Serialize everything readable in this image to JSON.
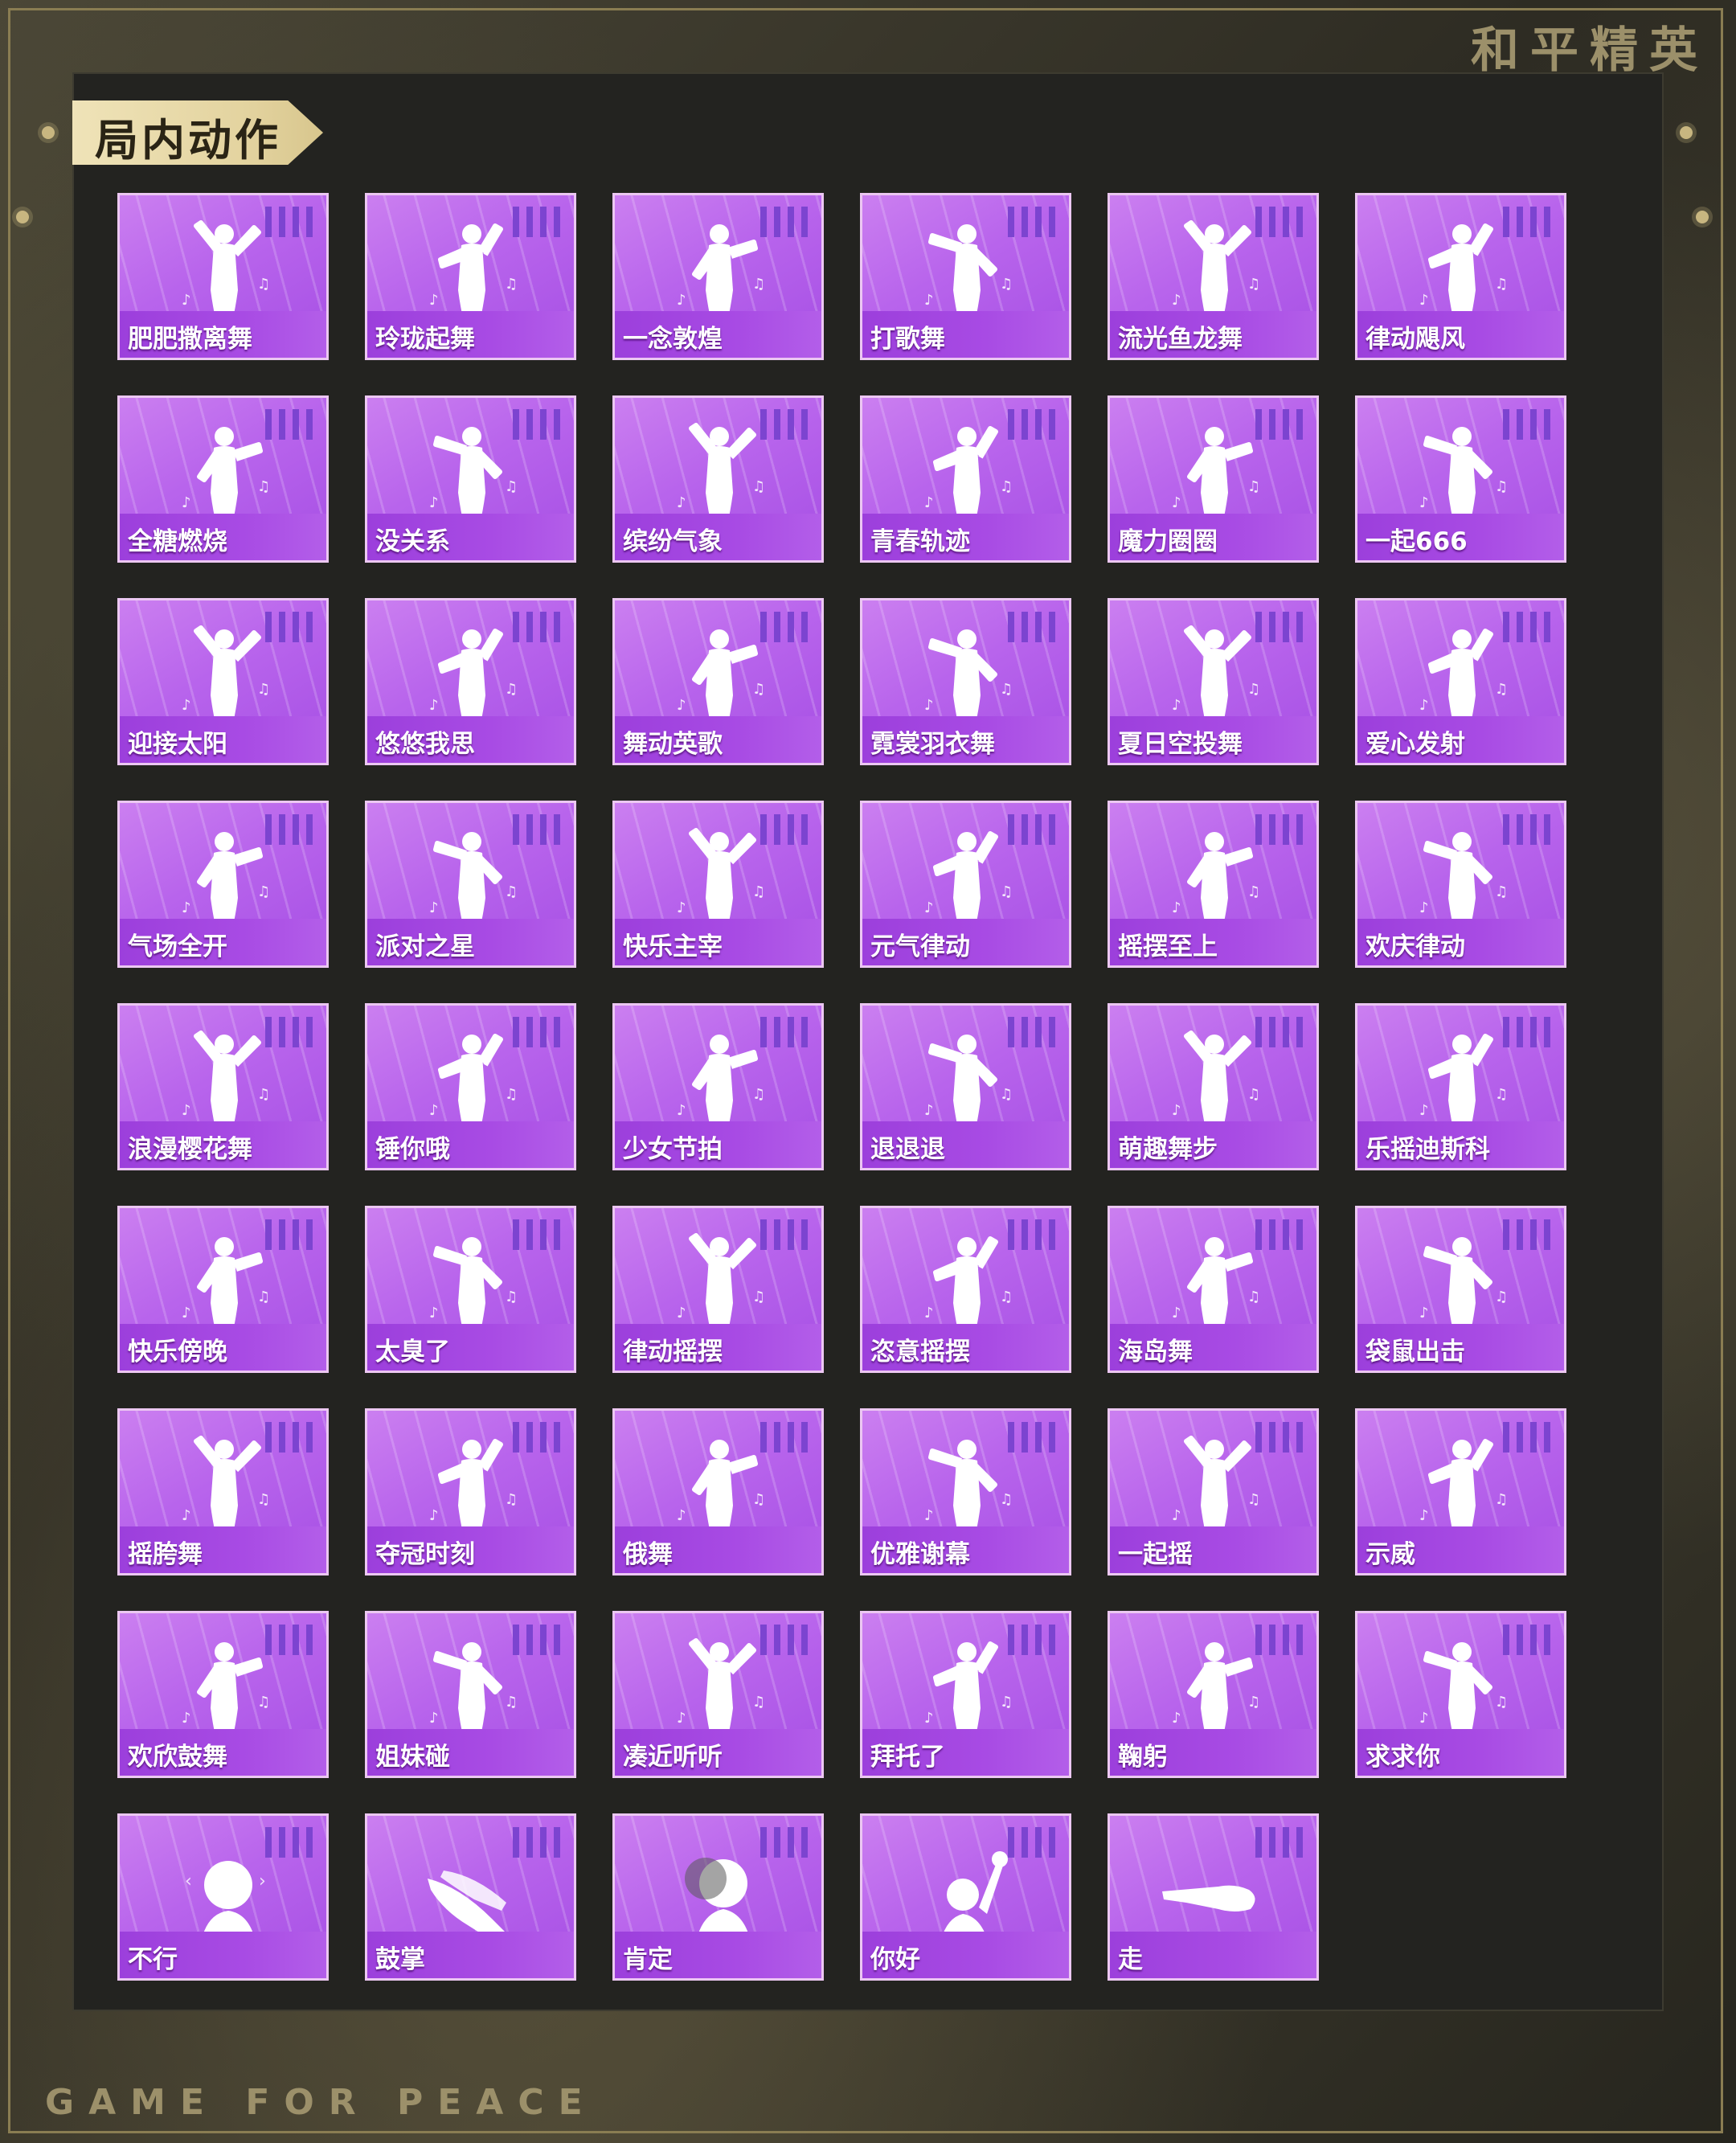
{
  "header": {
    "brand": "和平精英",
    "section_title": "局内动作",
    "slogan": "GAME FOR PEACE"
  },
  "colors": {
    "card_purple": "#b864ec",
    "card_border": "#ecc7f2",
    "title_tag": "#e8dbaa",
    "gold": "#9c906a"
  },
  "emotes": [
    {
      "label": "肥肥撒离舞",
      "icon": "dancer-icon"
    },
    {
      "label": "玲珑起舞",
      "icon": "dancer-icon"
    },
    {
      "label": "一念敦煌",
      "icon": "dancer-icon"
    },
    {
      "label": "打歌舞",
      "icon": "dancer-icon"
    },
    {
      "label": "流光鱼龙舞",
      "icon": "dancer-icon"
    },
    {
      "label": "律动飓风",
      "icon": "dancer-icon"
    },
    {
      "label": "全糖燃烧",
      "icon": "dancer-icon"
    },
    {
      "label": "没关系",
      "icon": "dancer-icon"
    },
    {
      "label": "缤纷气象",
      "icon": "dancer-icon"
    },
    {
      "label": "青春轨迹",
      "icon": "dancer-icon"
    },
    {
      "label": "魔力圈圈",
      "icon": "dancer-icon"
    },
    {
      "label": "一起666",
      "icon": "dancer-icon"
    },
    {
      "label": "迎接太阳",
      "icon": "dancer-icon"
    },
    {
      "label": "悠悠我思",
      "icon": "dancer-icon"
    },
    {
      "label": "舞动英歌",
      "icon": "dancer-icon"
    },
    {
      "label": "霓裳羽衣舞",
      "icon": "dancer-icon"
    },
    {
      "label": "夏日空投舞",
      "icon": "dancer-icon"
    },
    {
      "label": "爱心发射",
      "icon": "dancer-icon"
    },
    {
      "label": "气场全开",
      "icon": "dancer-icon"
    },
    {
      "label": "派对之星",
      "icon": "dancer-icon"
    },
    {
      "label": "快乐主宰",
      "icon": "dancer-icon"
    },
    {
      "label": "元气律动",
      "icon": "dancer-icon"
    },
    {
      "label": "摇摆至上",
      "icon": "dancer-icon"
    },
    {
      "label": "欢庆律动",
      "icon": "dancer-icon"
    },
    {
      "label": "浪漫樱花舞",
      "icon": "dancer-icon"
    },
    {
      "label": "锤你哦",
      "icon": "dancer-icon"
    },
    {
      "label": "少女节拍",
      "icon": "dancer-icon"
    },
    {
      "label": "退退退",
      "icon": "dancer-icon"
    },
    {
      "label": "萌趣舞步",
      "icon": "dancer-icon"
    },
    {
      "label": "乐摇迪斯科",
      "icon": "dancer-icon"
    },
    {
      "label": "快乐傍晚",
      "icon": "dancer-icon"
    },
    {
      "label": "太臭了",
      "icon": "dancer-icon"
    },
    {
      "label": "律动摇摆",
      "icon": "dancer-icon"
    },
    {
      "label": "恣意摇摆",
      "icon": "dancer-icon"
    },
    {
      "label": "海岛舞",
      "icon": "dancer-icon"
    },
    {
      "label": "袋鼠出击",
      "icon": "dancer-icon"
    },
    {
      "label": "摇胯舞",
      "icon": "dancer-icon"
    },
    {
      "label": "夺冠时刻",
      "icon": "dancer-icon"
    },
    {
      "label": "俄舞",
      "icon": "dancer-icon"
    },
    {
      "label": "优雅谢幕",
      "icon": "dancer-icon"
    },
    {
      "label": "一起摇",
      "icon": "dancer-icon"
    },
    {
      "label": "示威",
      "icon": "dancer-icon"
    },
    {
      "label": "欢欣鼓舞",
      "icon": "dancer-icon"
    },
    {
      "label": "姐妹碰",
      "icon": "dancer-icon"
    },
    {
      "label": "凑近听听",
      "icon": "dancer-icon"
    },
    {
      "label": "拜托了",
      "icon": "dancer-icon"
    },
    {
      "label": "鞠躬",
      "icon": "dancer-icon"
    },
    {
      "label": "求求你",
      "icon": "dancer-icon"
    },
    {
      "label": "不行",
      "icon": "head-shake-icon"
    },
    {
      "label": "鼓掌",
      "icon": "clap-hands-icon"
    },
    {
      "label": "肯定",
      "icon": "head-nod-icon"
    },
    {
      "label": "你好",
      "icon": "wave-hand-icon"
    },
    {
      "label": "走",
      "icon": "pointing-hand-icon"
    }
  ]
}
